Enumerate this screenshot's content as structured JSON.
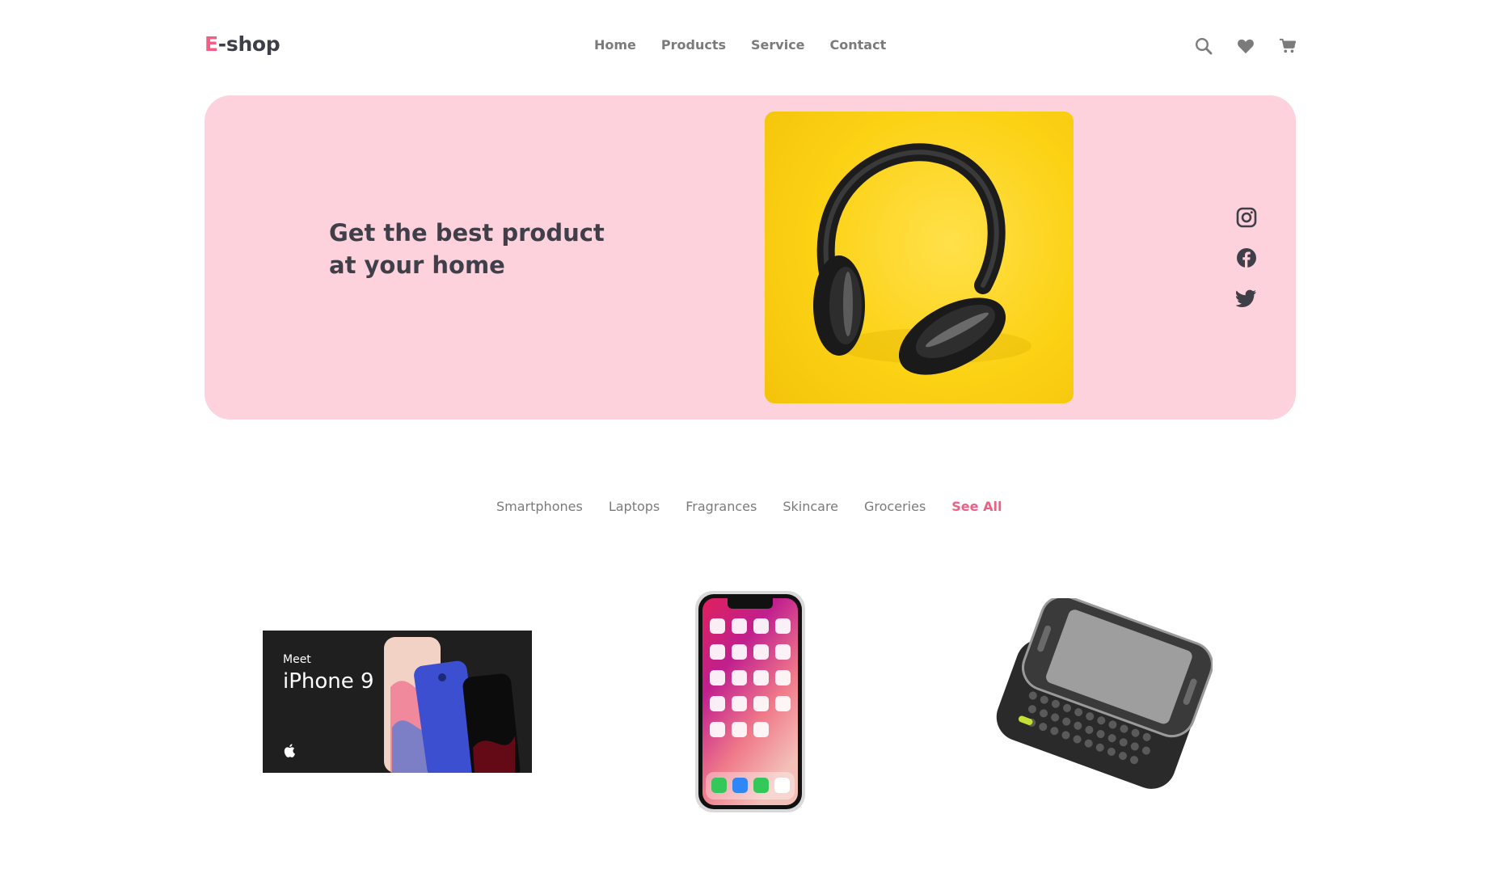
{
  "header": {
    "logo_accent": "E",
    "logo_rest": "-shop",
    "nav": [
      "Home",
      "Products",
      "Service",
      "Contact"
    ],
    "icons": [
      "search-icon",
      "heart-icon",
      "cart-icon"
    ]
  },
  "hero": {
    "title_line1": "Get the best product",
    "title_line2": "at your home",
    "image": "headphones-on-yellow-background",
    "social": [
      "instagram-icon",
      "facebook-icon",
      "twitter-icon"
    ]
  },
  "categories": {
    "items": [
      "Smartphones",
      "Laptops",
      "Fragrances",
      "Skincare",
      "Groceries"
    ],
    "see_all": "See All"
  },
  "products": {
    "p1": {
      "meet": "Meet",
      "name": "iPhone 9"
    },
    "p2": {
      "image": "iphone-x-front"
    },
    "p3": {
      "image": "slider-phone-keyboard"
    }
  },
  "colors": {
    "accent": "#ef5f86",
    "hero_bg": "#fdd2dc",
    "text_dark": "#3f3f4a",
    "text_muted": "#7b7b7b"
  }
}
